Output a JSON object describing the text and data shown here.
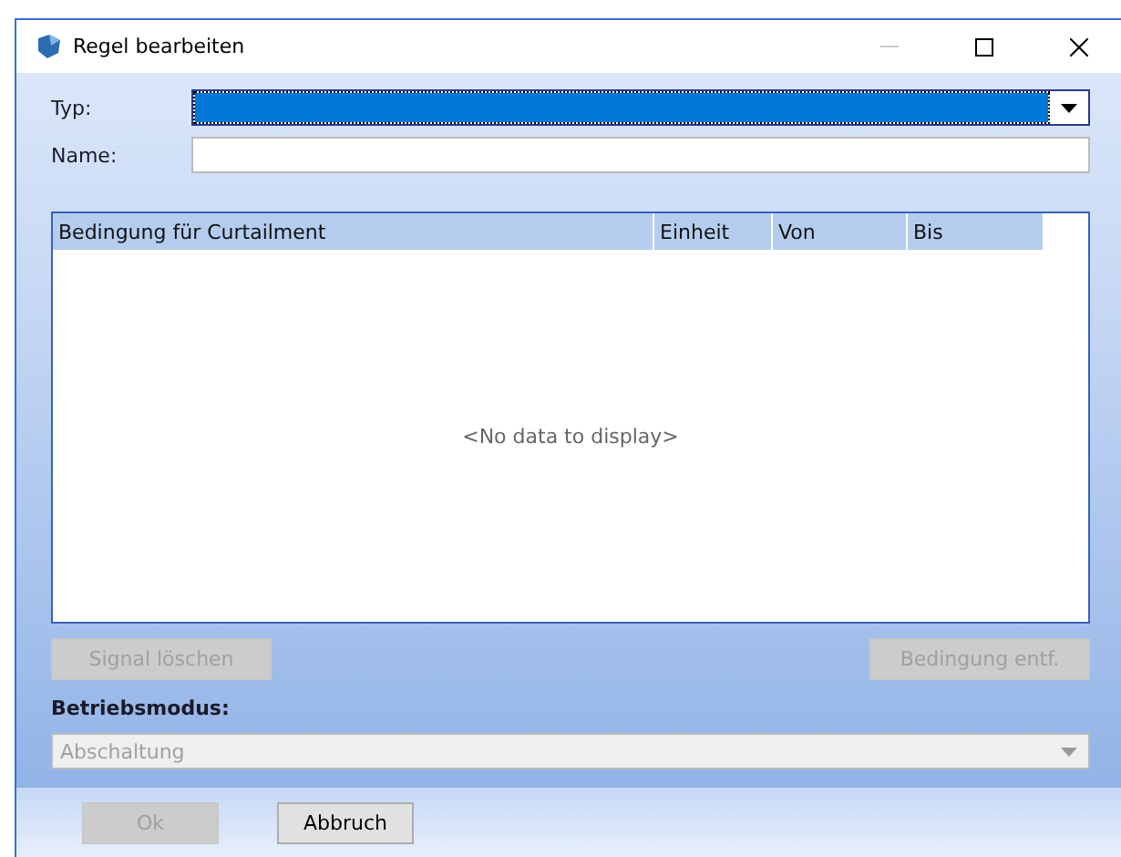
{
  "window": {
    "title": "Regel bearbeiten"
  },
  "form": {
    "type_label": "Typ:",
    "type_focused": true,
    "name_label": "Name:"
  },
  "table": {
    "columns": [
      "Bedingung für Curtailment",
      "Einheit",
      "Von",
      "Bis"
    ],
    "empty_text": "<No data to display>"
  },
  "table_buttons": [
    {
      "label": "Signal löschen",
      "disabled": true
    },
    {
      "label": "Bedingung entf.",
      "disabled": true
    }
  ],
  "mode": {
    "label": "Betriebsmodus:",
    "value": "Abschaltung",
    "disabled": true
  },
  "buttons": [
    {
      "label": "Ok",
      "disabled": true
    },
    {
      "label": "Abbruch",
      "disabled": false
    }
  ]
}
